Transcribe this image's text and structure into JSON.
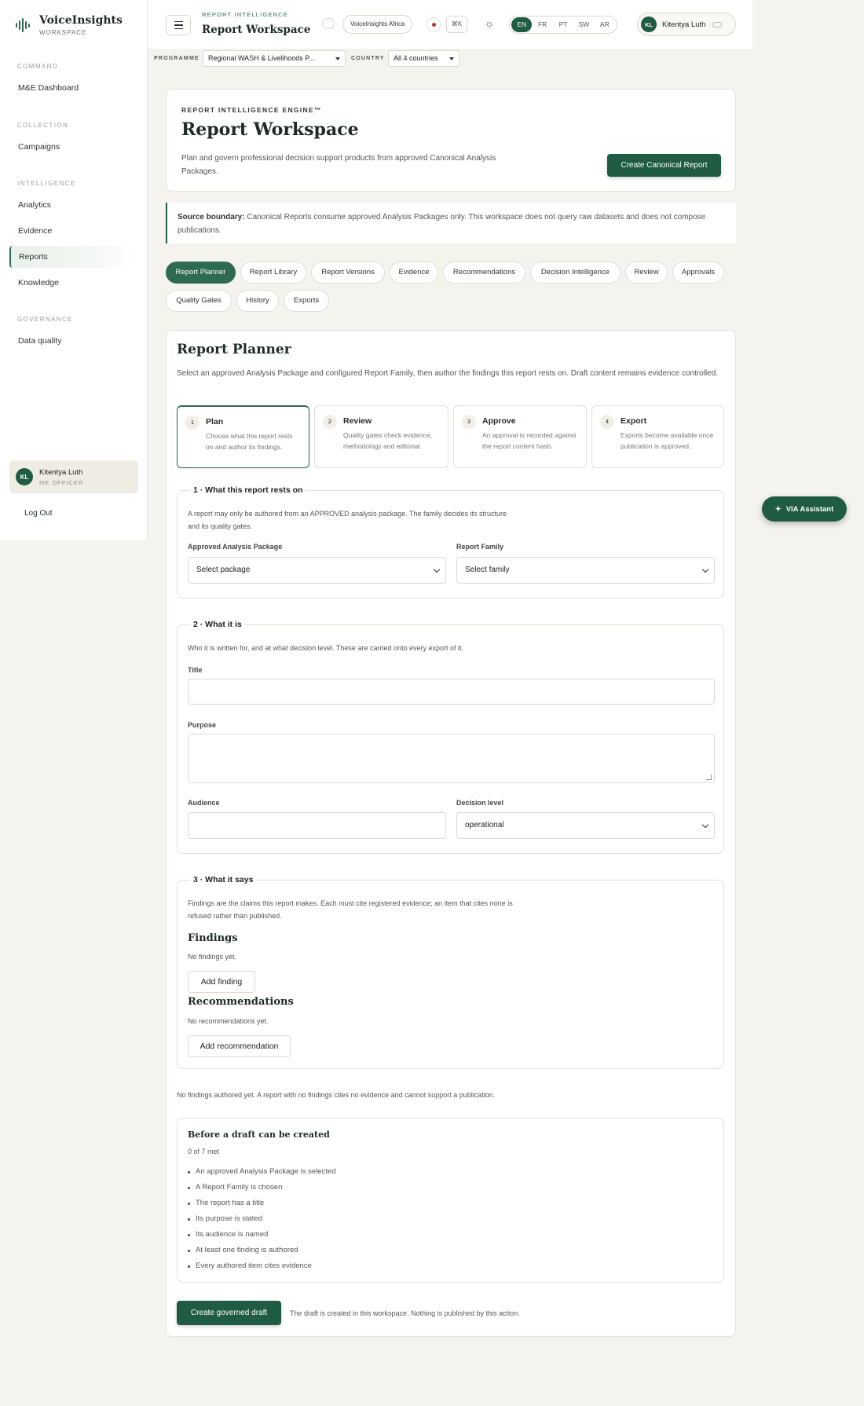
{
  "brand": {
    "name": "VoiceInsights",
    "sub": "WORKSPACE"
  },
  "sidebar": {
    "sections": [
      {
        "label": "COMMAND",
        "items": [
          "M&E Dashboard"
        ]
      },
      {
        "label": "COLLECTION",
        "items": [
          "Campaigns"
        ]
      },
      {
        "label": "INTELLIGENCE",
        "items": [
          "Analytics",
          "Evidence",
          "Reports",
          "Knowledge"
        ]
      },
      {
        "label": "GOVERNANCE",
        "items": [
          "Data quality"
        ]
      }
    ],
    "active_item": "Reports",
    "user": {
      "initials": "KL",
      "name": "Kitentya Luth",
      "role": "ME OFFICER"
    },
    "logout": "Log Out"
  },
  "header": {
    "eyebrow": "REPORT INTELLIGENCE",
    "title": "Report Workspace",
    "org": "VoiceInsights Africa",
    "kbd": "⌘K",
    "languages": [
      "EN",
      "FR",
      "PT",
      "SW",
      "AR"
    ],
    "active_language": "EN",
    "user": {
      "initials": "KL",
      "name": "Kitentya Luth"
    }
  },
  "filters": {
    "programme_label": "PROGRAMME",
    "programme_value": "Regional WASH & Livelihoods P...",
    "country_label": "COUNTRY",
    "country_value": "All 4 countries"
  },
  "hero": {
    "eyebrow": "REPORT INTELLIGENCE ENGINE™",
    "title": "Report Workspace",
    "description": "Plan and govern professional decision support products from approved Canonical Analysis Packages.",
    "cta": "Create Canonical Report"
  },
  "boundary": {
    "label": "Source boundary:",
    "text": " Canonical Reports consume approved Analysis Packages only. This workspace does not query raw datasets and does not compose publications."
  },
  "tabs": [
    "Report Planner",
    "Report Library",
    "Report Versions",
    "Evidence",
    "Recommendations",
    "Decision Intelligence",
    "Review",
    "Approvals",
    "Quality Gates",
    "History",
    "Exports"
  ],
  "active_tab": "Report Planner",
  "planner": {
    "title": "Report Planner",
    "description": "Select an approved Analysis Package and configured Report Family, then author the findings this report rests on. Draft content remains evidence controlled.",
    "steps": [
      {
        "num": "1",
        "title": "Plan",
        "desc": "Choose what this report rests on and author its findings."
      },
      {
        "num": "2",
        "title": "Review",
        "desc": "Quality gates check evidence, methodology and editorial."
      },
      {
        "num": "3",
        "title": "Approve",
        "desc": "An approval is recorded against the report content hash."
      },
      {
        "num": "4",
        "title": "Export",
        "desc": "Exports become available once publication is approved."
      }
    ],
    "section1": {
      "title": "1 · What this report rests on",
      "desc": "A report may only be authored from an APPROVED analysis package. The family decides its structure and its quality gates.",
      "package_label": "Approved Analysis Package",
      "package_value": "Select package",
      "family_label": "Report Family",
      "family_value": "Select family"
    },
    "section2": {
      "title": "2 · What it is",
      "desc": "Who it is written for, and at what decision level. These are carried onto every export of it.",
      "title_label": "Title",
      "purpose_label": "Purpose",
      "audience_label": "Audience",
      "decision_label": "Decision level",
      "decision_value": "operational"
    },
    "section3": {
      "title": "3 · What it says",
      "desc": "Findings are the claims this report makes. Each must cite registered evidence; an item that cites none is refused rather than published.",
      "findings_heading": "Findings",
      "findings_empty": "No findings yet.",
      "add_finding": "Add finding",
      "recs_heading": "Recommendations",
      "recs_empty": "No recommendations yet.",
      "add_rec": "Add recommendation"
    },
    "note": "No findings authored yet. A report with no findings cites no evidence and cannot support a publication.",
    "checklist": {
      "title": "Before a draft can be created",
      "count": "0 of 7 met",
      "items": [
        "An approved Analysis Package is selected",
        "A Report Family is chosen",
        "The report has a title",
        "Its purpose is stated",
        "Its audience is named",
        "At least one finding is authored",
        "Every authored item cites evidence"
      ]
    },
    "create_btn": "Create governed draft",
    "create_note": "The draft is created in this workspace. Nothing is published by this action."
  },
  "assistant": "VIA Assistant",
  "colors": {
    "brand": "#1f5c43",
    "accent": "#2e6b4f",
    "alert": "#b5321f"
  }
}
